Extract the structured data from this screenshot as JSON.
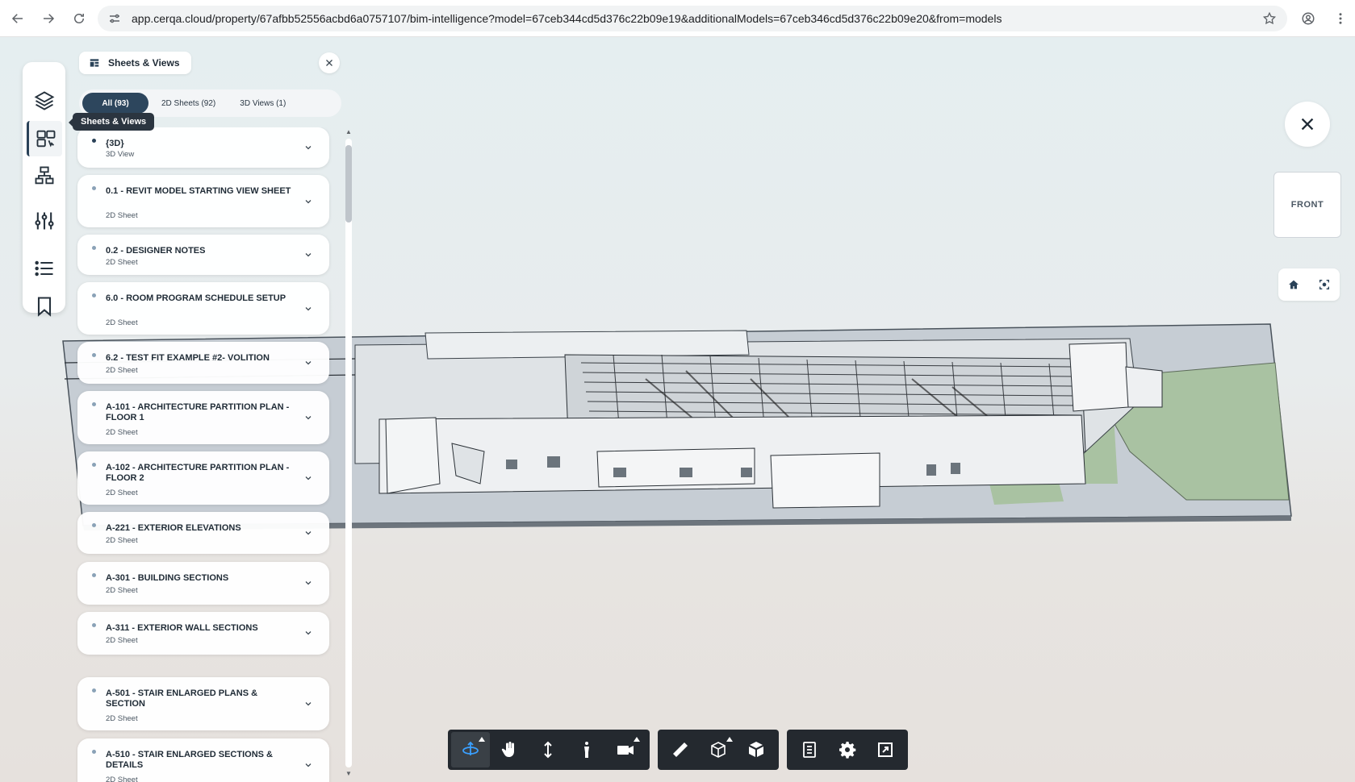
{
  "browser": {
    "url": "app.cerqa.cloud/property/67afbb52556acbd6a0757107/bim-intelligence?model=67ceb344cd5d376c22b09e19&additionalModels=67ceb346cd5d376c22b09e20&from=models",
    "icons": {
      "back": "arrow-left-icon",
      "forward": "arrow-right-icon",
      "reload": "reload-icon",
      "site": "site-settings-icon",
      "star": "bookmark-star-icon",
      "profile": "profile-icon",
      "menu": "kebab-menu-icon"
    }
  },
  "left_rail": {
    "tooltip": "Sheets & Views",
    "items": [
      {
        "name": "layers",
        "icon": "layers-icon"
      },
      {
        "name": "sheets-views",
        "icon": "sheets-views-icon",
        "active": true
      },
      {
        "name": "model-tree",
        "icon": "hierarchy-icon"
      },
      {
        "name": "filters",
        "icon": "sliders-icon"
      },
      {
        "name": "list",
        "icon": "list-icon"
      },
      {
        "name": "bookmarks",
        "icon": "bookmark-icon"
      }
    ]
  },
  "panel": {
    "title": "Sheets & Views",
    "tabs": [
      {
        "label": "All (93)",
        "active": true
      },
      {
        "label": "2D Sheets (92)",
        "active": false
      },
      {
        "label": "3D Views (1)",
        "active": false
      }
    ],
    "items": [
      {
        "title": "{3D}",
        "type": "3D View"
      },
      {
        "title": "0.1 - REVIT MODEL STARTING VIEW SHEET",
        "type": "2D Sheet"
      },
      {
        "title": "0.2 - DESIGNER NOTES",
        "type": "2D Sheet"
      },
      {
        "title": "6.0 - ROOM PROGRAM SCHEDULE SETUP",
        "type": "2D Sheet"
      },
      {
        "title": "6.2 - TEST FIT EXAMPLE #2- VOLITION",
        "type": "2D Sheet"
      },
      {
        "title": "A-101 - ARCHITECTURE PARTITION PLAN - FLOOR 1",
        "type": "2D Sheet"
      },
      {
        "title": "A-102 - ARCHITECTURE PARTITION PLAN - FLOOR 2",
        "type": "2D Sheet"
      },
      {
        "title": "A-221 - EXTERIOR ELEVATIONS",
        "type": "2D Sheet"
      },
      {
        "title": "A-301 - BUILDING SECTIONS",
        "type": "2D Sheet"
      },
      {
        "title": "A-311 - EXTERIOR WALL SECTIONS",
        "type": "2D Sheet"
      },
      {
        "title": "A-501 - STAIR ENLARGED PLANS & SECTION",
        "type": "2D Sheet"
      },
      {
        "title": "A-510 - STAIR ENLARGED SECTIONS & DETAILS",
        "type": "2D Sheet"
      }
    ]
  },
  "viewer": {
    "viewcube_label": "FRONT",
    "accent_color": "#2d465d",
    "active_tool_color": "#3aa0ff",
    "toolbar_groups": [
      [
        "orbit-icon",
        "pan-hand-icon",
        "zoom-vertical-icon",
        "walk-person-icon",
        "camera-icon"
      ],
      [
        "measure-ruler-icon",
        "section-box-icon",
        "explode-cube-icon"
      ],
      [
        "model-browser-icon",
        "settings-gear-icon",
        "fullscreen-icon"
      ]
    ]
  }
}
